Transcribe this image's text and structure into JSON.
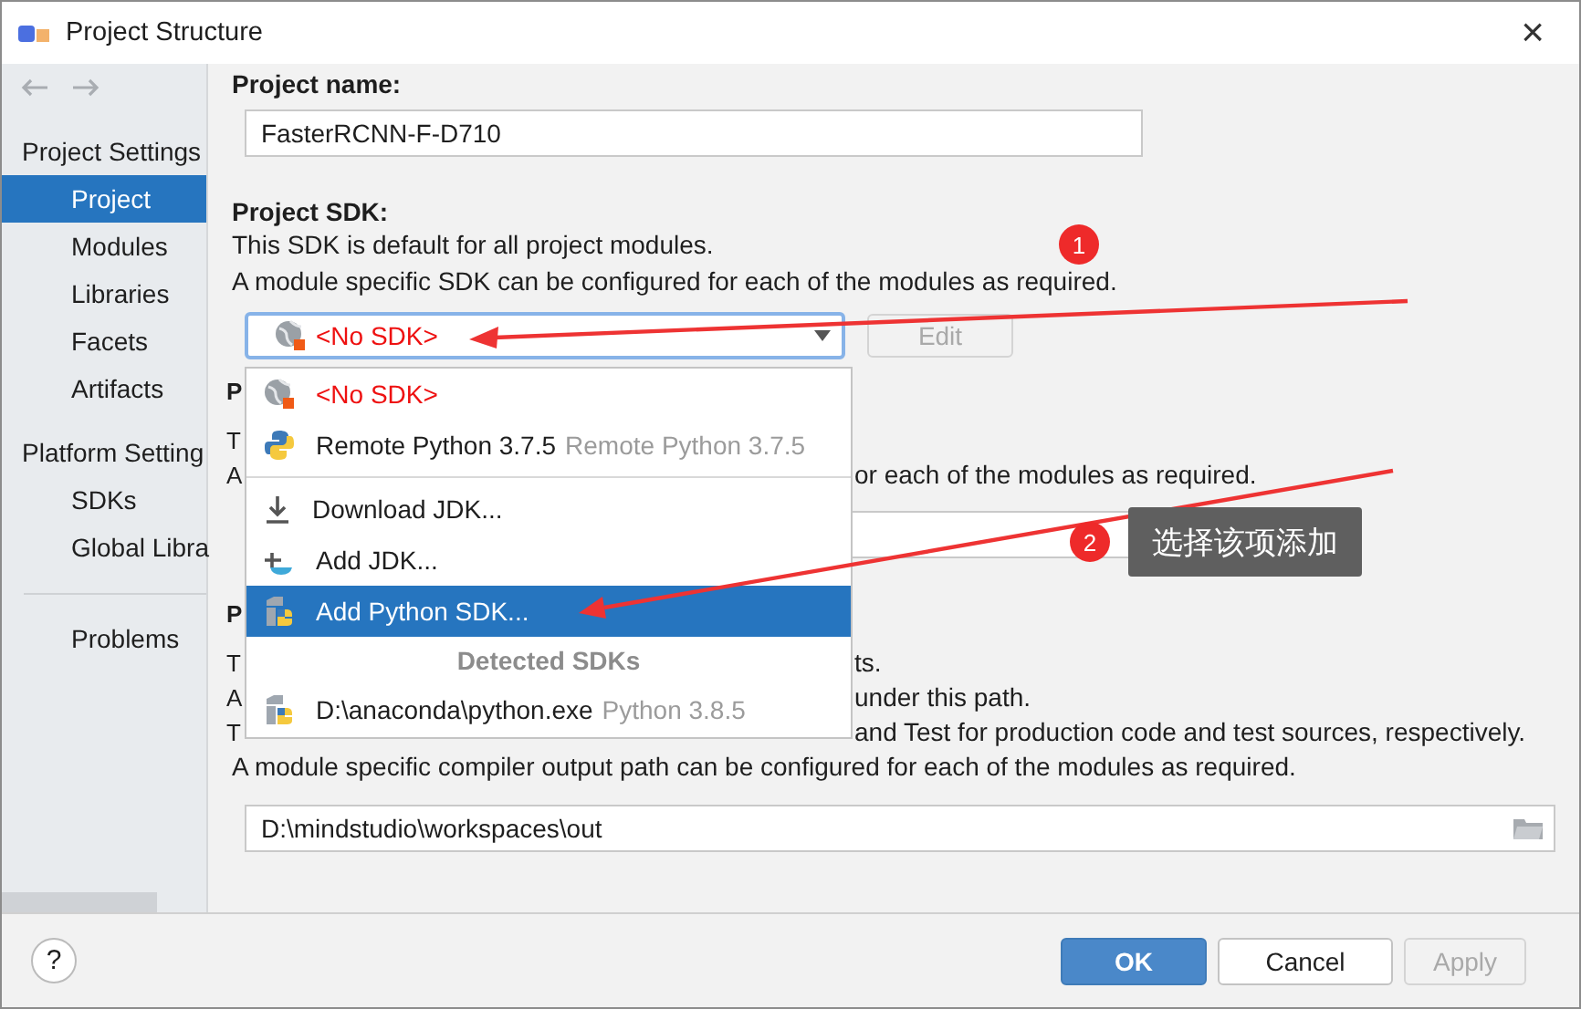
{
  "window": {
    "title": "Project Structure",
    "close": "×"
  },
  "sidebar": {
    "groups": [
      {
        "heading": "Project Settings",
        "items": [
          {
            "label": "Project",
            "selected": true
          },
          {
            "label": "Modules",
            "selected": false
          },
          {
            "label": "Libraries",
            "selected": false
          },
          {
            "label": "Facets",
            "selected": false
          },
          {
            "label": "Artifacts",
            "selected": false
          }
        ]
      },
      {
        "heading": "Platform Setting",
        "items": [
          {
            "label": "SDKs",
            "selected": false
          },
          {
            "label": "Global Libra",
            "selected": false
          }
        ]
      }
    ],
    "bottom_items": [
      {
        "label": "Problems",
        "selected": false
      }
    ]
  },
  "project_name": {
    "label": "Project name:",
    "value": "FasterRCNN-F-D710"
  },
  "project_sdk": {
    "label": "Project SDK:",
    "lines": [
      "This SDK is default for all project modules.",
      "A module specific SDK can be configured for each of the modules as required."
    ],
    "combo": {
      "value": "<No SDK>",
      "error": true
    },
    "edit_button": {
      "label": "Edit",
      "disabled": true
    }
  },
  "partly_hidden_lines": [
    {
      "kind": "heading",
      "left": "P"
    },
    {
      "kind": "text",
      "left": "T"
    },
    {
      "kind": "text",
      "left": "A",
      "right": "or each of the modules as required."
    },
    {
      "kind": "field"
    },
    {
      "kind": "heading",
      "left": "P"
    },
    {
      "kind": "text",
      "left": "T",
      "right": "ts."
    },
    {
      "kind": "text",
      "left": "A",
      "right": "under this path."
    },
    {
      "kind": "text",
      "left": "T",
      "right": "and Test for production code and test sources, respectively."
    }
  ],
  "compiler_output": {
    "line": "A module specific compiler output path can be configured for each of the modules as required.",
    "path": "D:\\mindstudio\\workspaces\\out"
  },
  "dropdown": {
    "items": [
      {
        "kind": "missing",
        "label": "<No SDK>",
        "selected": false,
        "separator_after": false
      },
      {
        "kind": "remote",
        "label": "Remote Python 3.7.5",
        "detail": "Remote Python 3.7.5",
        "selected": false,
        "separator_after": true
      },
      {
        "kind": "download",
        "label": "Download JDK...",
        "selected": false,
        "separator_after": false
      },
      {
        "kind": "jdk",
        "label": "Add JDK...",
        "selected": false,
        "separator_after": false
      },
      {
        "kind": "python",
        "label": "Add Python SDK...",
        "selected": true,
        "separator_after": false
      },
      {
        "kind": "header",
        "label": "Detected SDKs",
        "selected": false,
        "separator_after": false
      },
      {
        "kind": "python",
        "label": "D:\\anaconda\\python.exe",
        "detail": "Python 3.8.5",
        "selected": false,
        "separator_after": false
      }
    ]
  },
  "annotations": {
    "badges": [
      "1",
      "2"
    ],
    "tooltip": "选择该项添加"
  },
  "footer": {
    "help": "?",
    "buttons": [
      {
        "label": "OK",
        "primary": true,
        "disabled": false
      },
      {
        "label": "Cancel",
        "primary": false,
        "disabled": false
      },
      {
        "label": "Apply",
        "primary": false,
        "disabled": true
      }
    ]
  }
}
